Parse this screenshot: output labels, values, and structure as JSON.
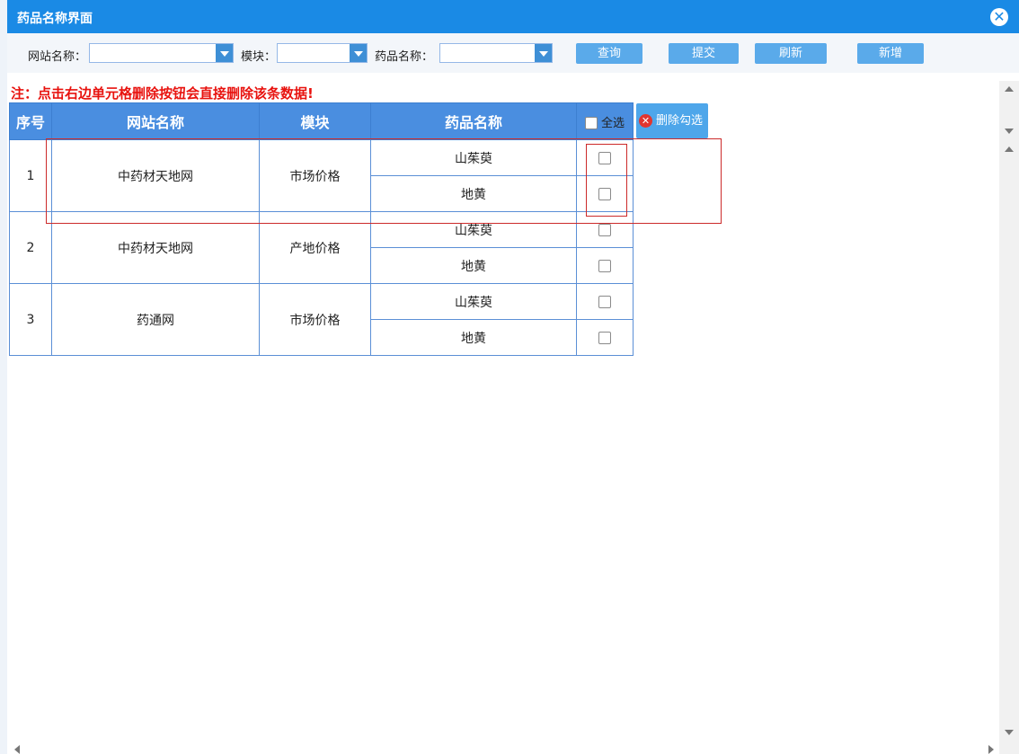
{
  "dialog": {
    "title": "药品名称界面",
    "close_icon": "close-circle-icon"
  },
  "toolbar": {
    "site_label": "网站名称：",
    "module_label": "模块：",
    "drug_label": "药品名称：",
    "site_value": "",
    "module_value": "",
    "drug_value": "",
    "query": "查询",
    "submit": "提交",
    "refresh": "刷新",
    "add": "新增"
  },
  "notice": "注：点击右边单元格删除按钮会直接删除该条数据!",
  "table": {
    "headers": {
      "seq": "序号",
      "site": "网站名称",
      "module": "模块",
      "drug": "药品名称",
      "select_all": "全选"
    },
    "delete_checked": "删除勾选",
    "rows": [
      {
        "seq": "1",
        "site": "中药材天地网",
        "module": "市场价格",
        "drugs": [
          "山茱萸",
          "地黄"
        ]
      },
      {
        "seq": "2",
        "site": "中药材天地网",
        "module": "产地价格",
        "drugs": [
          "山茱萸",
          "地黄"
        ]
      },
      {
        "seq": "3",
        "site": "药通网",
        "module": "市场价格",
        "drugs": [
          "山茱萸",
          "地黄"
        ]
      }
    ]
  },
  "colors": {
    "title_bar": "#1a8ae5",
    "header": "#4a8ee0",
    "button": "#5aaaea",
    "notice": "#e8120e",
    "highlight": "#cc2a2a"
  }
}
